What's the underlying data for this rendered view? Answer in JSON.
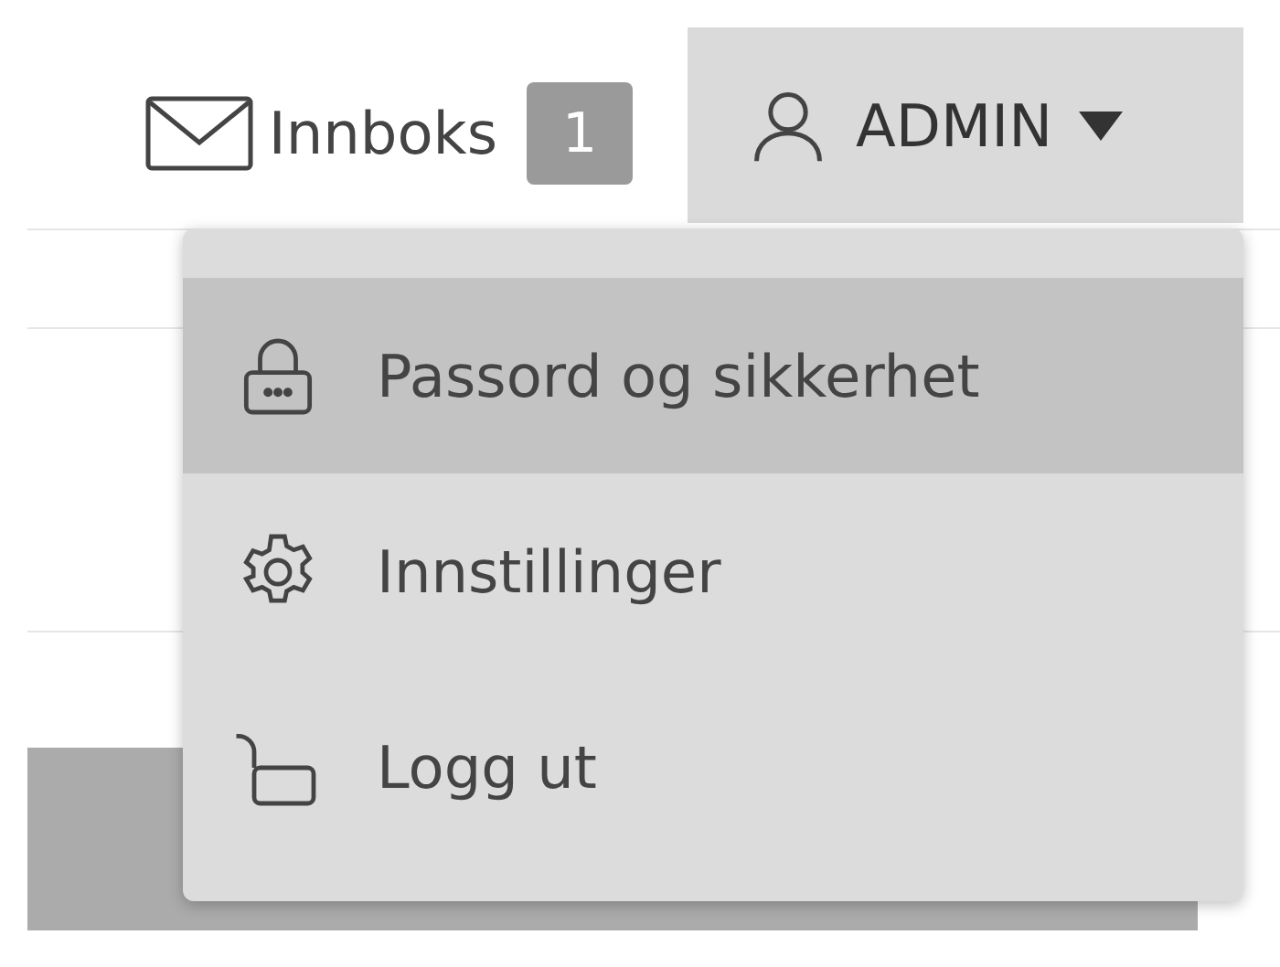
{
  "header": {
    "inbox": {
      "label": "Innboks",
      "count": "1"
    },
    "user": {
      "name": "ADMIN",
      "expanded": true
    }
  },
  "user_menu": [
    {
      "kind": "lock",
      "label": "Passord og sikkerhet",
      "selected": true
    },
    {
      "kind": "gear",
      "label": "Innstillinger",
      "selected": false
    },
    {
      "kind": "unlock",
      "label": "Logg ut",
      "selected": false
    }
  ]
}
